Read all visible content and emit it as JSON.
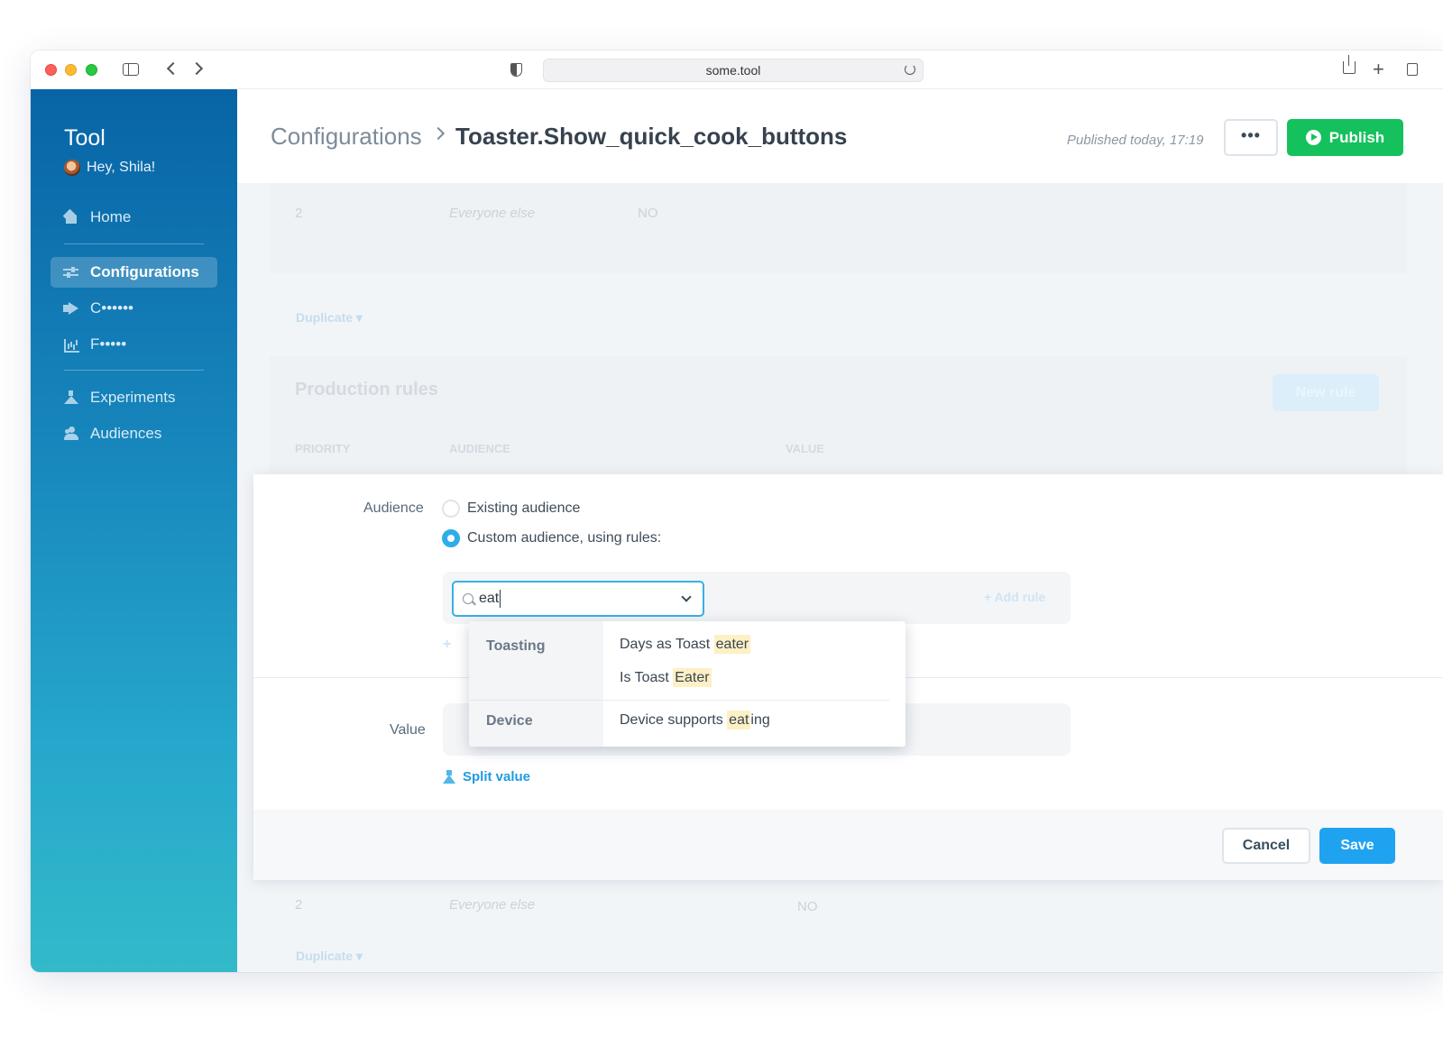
{
  "browser": {
    "url": "some.tool"
  },
  "sidebar": {
    "app_title": "Tool",
    "greeting": "Hey, Shila!",
    "items": [
      {
        "label": "Home",
        "icon": "home-icon"
      },
      {
        "label": "Configurations",
        "icon": "sliders-icon",
        "active": true
      },
      {
        "label": "C••••••",
        "icon": "megaphone-icon"
      },
      {
        "label": "F•••••",
        "icon": "chart-icon"
      },
      {
        "label": "Experiments",
        "icon": "flask-icon"
      },
      {
        "label": "Audiences",
        "icon": "users-icon"
      }
    ]
  },
  "header": {
    "breadcrumb_root": "Configurations",
    "breadcrumb_current": "Toaster.Show_quick_cook_buttons",
    "published": "Published today, 17:19",
    "more_label": "•••",
    "publish_label": "Publish"
  },
  "background": {
    "top_row": {
      "priority": "2",
      "audience": "Everyone else",
      "value": "NO"
    },
    "duplicate_label": "Duplicate ▾",
    "section_title": "Production rules",
    "new_rule_label": "New rule",
    "columns": [
      "PRIORITY",
      "AUDIENCE",
      "VALUE"
    ],
    "bottom_row": {
      "priority": "2",
      "audience": "Everyone else",
      "value": "NO"
    }
  },
  "editor": {
    "audience_label": "Audience",
    "option_existing": "Existing audience",
    "option_custom": "Custom audience, using rules:",
    "search_value": "eat",
    "add_rule_label": "+ Add rule",
    "value_label": "Value",
    "split_value_label": "Split value",
    "cancel_label": "Cancel",
    "save_label": "Save"
  },
  "dropdown": {
    "groups": [
      {
        "name": "Toasting",
        "items": [
          {
            "pre": "Days as Toast ",
            "match": "eater",
            "post": ""
          },
          {
            "pre": "Is Toast ",
            "match": "Eater",
            "post": ""
          }
        ]
      },
      {
        "name": "Device",
        "items": [
          {
            "pre": "Device supports ",
            "match": "eat",
            "post": "ing"
          }
        ]
      }
    ]
  },
  "colors": {
    "sidebar_top": "#0864a6",
    "sidebar_bottom": "#33bac9",
    "publish_green": "#15c15d",
    "save_blue": "#1fa3f0",
    "highlight": "#fdf0c4"
  }
}
